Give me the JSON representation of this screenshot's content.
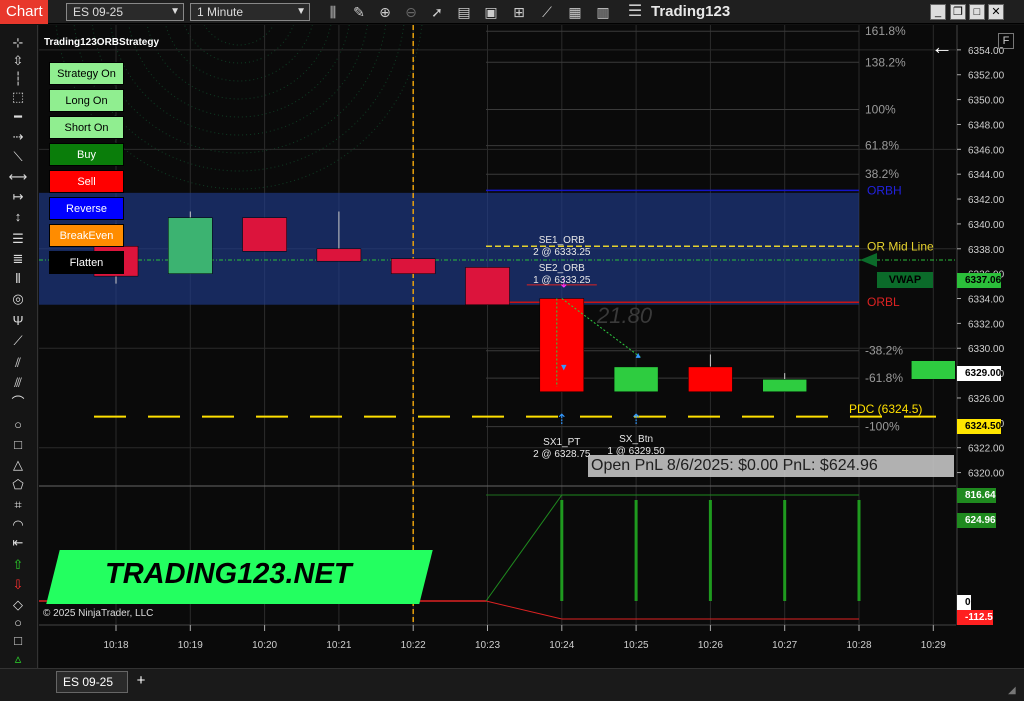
{
  "titlebar": {
    "chart_tab": "Chart",
    "instrument": "ES 09-25",
    "interval": "1 Minute",
    "title": "Trading123",
    "icons": [
      "bar-style-icon",
      "pencil-icon",
      "zoom-in-icon",
      "zoom-out-icon",
      "pointer-icon",
      "properties-icon",
      "data-box-icon",
      "chart-trader-icon",
      "strategy-icon",
      "indicator-icon",
      "template-icon",
      "menu-icon"
    ],
    "window_buttons": [
      "minimize",
      "restore",
      "maximize",
      "close"
    ]
  },
  "strategy": {
    "name": "Trading123ORBStrategy",
    "buttons": [
      {
        "label": "Strategy On",
        "style": "light"
      },
      {
        "label": "Long On",
        "style": "light"
      },
      {
        "label": "Short On",
        "style": "light"
      },
      {
        "label": "Buy",
        "style": "green"
      },
      {
        "label": "Sell",
        "style": "red"
      },
      {
        "label": "Reverse",
        "style": "blue"
      },
      {
        "label": "BreakEven",
        "style": "orange"
      },
      {
        "label": "Flatten",
        "style": "black"
      }
    ]
  },
  "chart": {
    "fib_labels": [
      "161.8%",
      "138.2%",
      "100%",
      "61.8%",
      "38.2%",
      "-38.2%",
      "-61.8%",
      "-100%"
    ],
    "line_labels": {
      "orbh": "ORBH",
      "mid": "OR Mid Line",
      "orbl": "ORBL",
      "pdc": "PDC (6324.5)",
      "vwap": "VWAP"
    },
    "trade_labels": {
      "se1_name": "SE1_ORB",
      "se1_fill": "2 @ 6333.25",
      "se2_name": "SE2_ORB",
      "se2_fill": "1 @ 6333.25",
      "sx1_name": "SX1_PT",
      "sx1_fill": "2 @ 6328.75",
      "sx_name": "SX_Btn",
      "sx_fill": "1 @ 6329.50"
    },
    "watermark": "21.80",
    "pnl": "Open PnL 8/6/2025: $0.00     PnL: $624.96",
    "banner": "TRADING123.NET",
    "copyright": "© 2025 NinjaTrader, LLC",
    "price_axis": [
      "6354.00",
      "6352.00",
      "6350.00",
      "6348.00",
      "6346.00",
      "6344.00",
      "6342.00",
      "6340.00",
      "6338.00",
      "6336.00",
      "6334.00",
      "6332.00",
      "6330.00",
      "6328.00",
      "6326.00",
      "6324.00",
      "6322.00",
      "6320.00"
    ],
    "price_tags": [
      {
        "label": "6337.06",
        "bg": "#2bbf3a",
        "fg": "#000"
      },
      {
        "label": "6329.00",
        "bg": "#ffffff",
        "fg": "#000"
      },
      {
        "label": "6324.50",
        "bg": "#ffe600",
        "fg": "#000"
      }
    ],
    "pnl_tags": [
      {
        "label": "816.64",
        "bg": "#1f8a1f",
        "fg": "#fff"
      },
      {
        "label": "624.96",
        "bg": "#1f8a1f",
        "fg": "#fff"
      },
      {
        "label": "0",
        "bg": "#ffffff",
        "fg": "#000"
      },
      {
        "label": "-112.5",
        "bg": "#ff2020",
        "fg": "#fff"
      }
    ],
    "time_labels": [
      "10:18",
      "10:19",
      "10:20",
      "10:21",
      "10:22",
      "10:23",
      "10:24",
      "10:25",
      "10:26",
      "10:27",
      "10:28",
      "10:29"
    ],
    "colors": {
      "bull": "#3cb371",
      "bear": "#dc143c",
      "orb_band": "#1e3a8a",
      "mid_line": "#e6d22e",
      "pdc_line": "#ffe000",
      "orbh_line": "#1414c8",
      "orbl_line": "#c81414",
      "vwap_line": "#2bbf3a"
    }
  },
  "candles": [
    {
      "t": "10:18",
      "o": 6338.2,
      "h": 6340.0,
      "l": 6335.2,
      "c": 6335.8
    },
    {
      "t": "10:19",
      "o": 6336.0,
      "h": 6341.0,
      "l": 6336.0,
      "c": 6340.5
    },
    {
      "t": "10:20",
      "o": 6340.5,
      "h": 6340.5,
      "l": 6337.8,
      "c": 6337.8
    },
    {
      "t": "10:21",
      "o": 6338.0,
      "h": 6341.0,
      "l": 6337.0,
      "c": 6337.0
    },
    {
      "t": "10:22",
      "o": 6337.2,
      "h": 6337.2,
      "l": 6336.0,
      "c": 6336.0
    },
    {
      "t": "10:23",
      "o": 6336.5,
      "h": 6336.5,
      "l": 6333.5,
      "c": 6333.5
    },
    {
      "t": "10:24",
      "o": 6334.0,
      "h": 6334.0,
      "l": 6326.5,
      "c": 6326.5
    },
    {
      "t": "10:25",
      "o": 6326.5,
      "h": 6328.5,
      "l": 6326.5,
      "c": 6328.5
    },
    {
      "t": "10:26",
      "o": 6328.5,
      "h": 6329.5,
      "l": 6326.5,
      "c": 6326.5
    },
    {
      "t": "10:27",
      "o": 6326.5,
      "h": 6328.0,
      "l": 6326.5,
      "c": 6327.5
    },
    {
      "t": "10:29",
      "o": 6327.5,
      "h": 6329.0,
      "l": 6327.5,
      "c": 6329.0
    }
  ],
  "bottombar": {
    "tab": "ES 09-25",
    "add": "+"
  }
}
